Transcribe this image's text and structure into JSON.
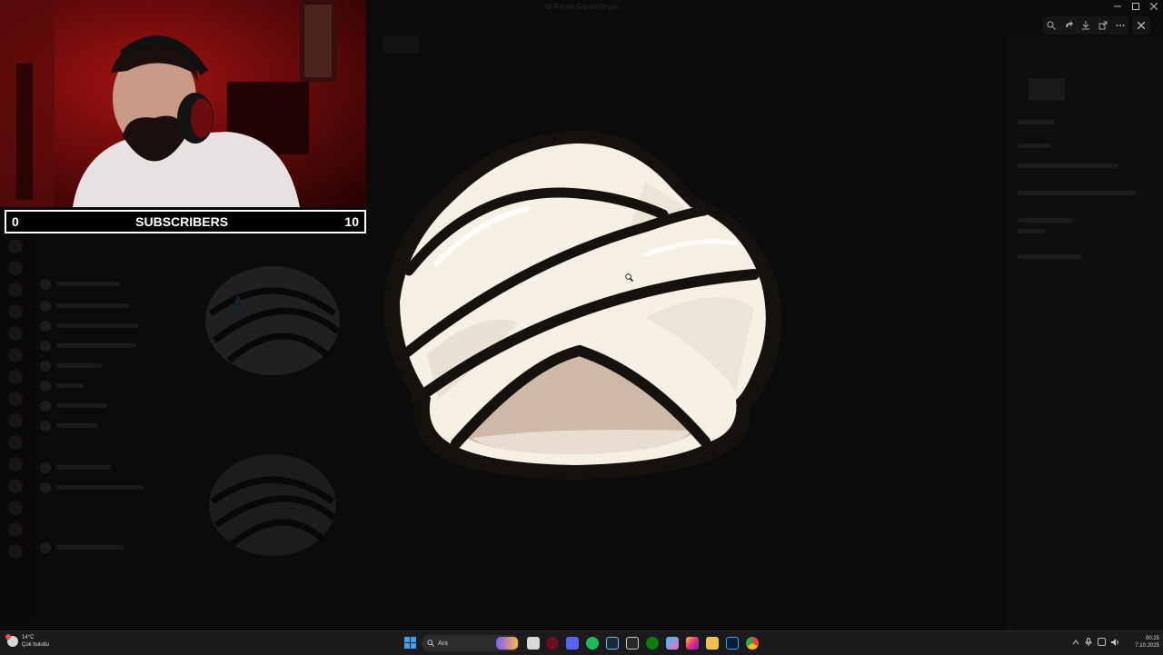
{
  "window": {
    "title": "Nt Resim Görüntüleyici"
  },
  "overlay": {
    "subscriber_bar": {
      "current": "0",
      "label": "SUBSCRIBERS",
      "goal": "10"
    }
  },
  "viewer": {
    "toolbar_icons": [
      "zoom-in-icon",
      "rotate-icon",
      "download-icon",
      "share-icon",
      "more-icon"
    ],
    "close_icon": "close-icon"
  },
  "taskbar": {
    "weather": {
      "temp": "14°C",
      "desc": "Çok bulutlu"
    },
    "search_placeholder": "Ara",
    "apps": [
      "file-explorer-icon",
      "opera-icon",
      "discord-icon",
      "spotify-icon",
      "steam-icon",
      "epic-games-icon",
      "xbox-icon",
      "copilot-icon",
      "instagram-icon",
      "folder-icon",
      "photoshop-icon",
      "chrome-icon"
    ],
    "clock": {
      "time": "00:25",
      "date": "7.10.2025"
    }
  },
  "colors": {
    "accent": "#3aa0f0",
    "turban_fill": "#f6f0e4",
    "turban_outline": "#15120d",
    "turban_base": "#cdb9a6"
  }
}
